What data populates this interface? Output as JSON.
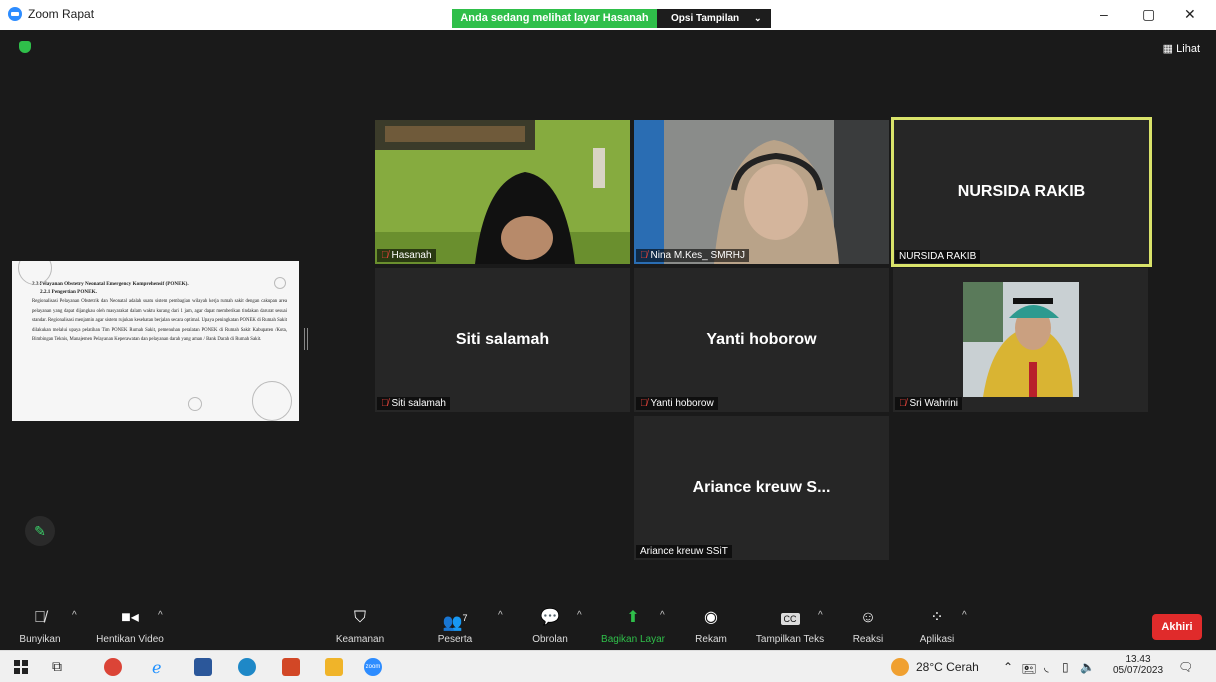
{
  "titlebar": {
    "app_title": "Zoom Rapat",
    "share_banner": "Anda sedang melihat layar Hasanah",
    "view_options": "Opsi Tampilan",
    "minimize": "–",
    "restore": "▢",
    "close": "✕"
  },
  "stage": {
    "view_label": "Lihat",
    "shared_doc": {
      "heading": "2.2  Pelayanan Obstetry Neonatal Emergency Komprehensif (PONEK).",
      "subheading": "2.2.1  Pengertian PONEK.",
      "body": "Regionalisasi Pelayanan Obstetrik dan Neonatal adalah suatu sistem pembagian wilayah kerja rumah sakit dengan cakupan area pelayanan yang dapat dijangkau oleh masyarakat dalam waktu kurang dari 1 jam, agar dapat memberikan tindakan darurat sesuai standar. Regionalisasi menjamin agar sistem rujukan kesehatan berjalan secara optimal. Upaya peningkatan PONEK di Rumah Sakit dilakukan melalui upaya pelatihan Tim PONEK Rumah Sakit, pemenuhan peralatan PONEK di Rumah Sakit Kabupaten /Kota, Bimbingan Teknis, Manajemen Pelayanan Keperawatan dan pelayanan darah yang aman / Bank Darah di Rumah Sakit."
    },
    "participants": [
      {
        "label": "Hasanah",
        "muted": true
      },
      {
        "label": "Nina M.Kes_ SMRHJ",
        "muted": true
      },
      {
        "center_name": "NURSIDA RAKIB",
        "label": "NURSIDA RAKIB",
        "muted": false
      },
      {
        "center_name": "Siti salamah",
        "label": "Siti salamah",
        "muted": true
      },
      {
        "center_name": "Yanti hoborow",
        "label": "Yanti hoborow",
        "muted": true
      },
      {
        "label": "Sri Wahrini",
        "muted": true
      },
      {
        "center_name": "Ariance kreuw S...",
        "label": "Ariance kreuw SSiT",
        "muted": false
      }
    ]
  },
  "toolbar": {
    "unmute": "Bunyikan",
    "stop_video": "Hentikan Video",
    "security": "Keamanan",
    "participants": "Peserta",
    "participant_count": "7",
    "chat": "Obrolan",
    "share_screen": "Bagikan Layar",
    "record": "Rekam",
    "captions": "Tampilkan Teks",
    "reactions": "Reaksi",
    "apps": "Aplikasi",
    "end": "Akhiri",
    "cc_badge": "CC"
  },
  "taskbar": {
    "weather": "28°C  Cerah",
    "time": "13.43",
    "date": "05/07/2023",
    "zoom_icon_text": "zoom"
  },
  "colors": {
    "share_green": "#2fbf4a",
    "active_speaker": "#d9e36a",
    "end_red": "#e02b2b",
    "muted_red": "#e0433a"
  }
}
